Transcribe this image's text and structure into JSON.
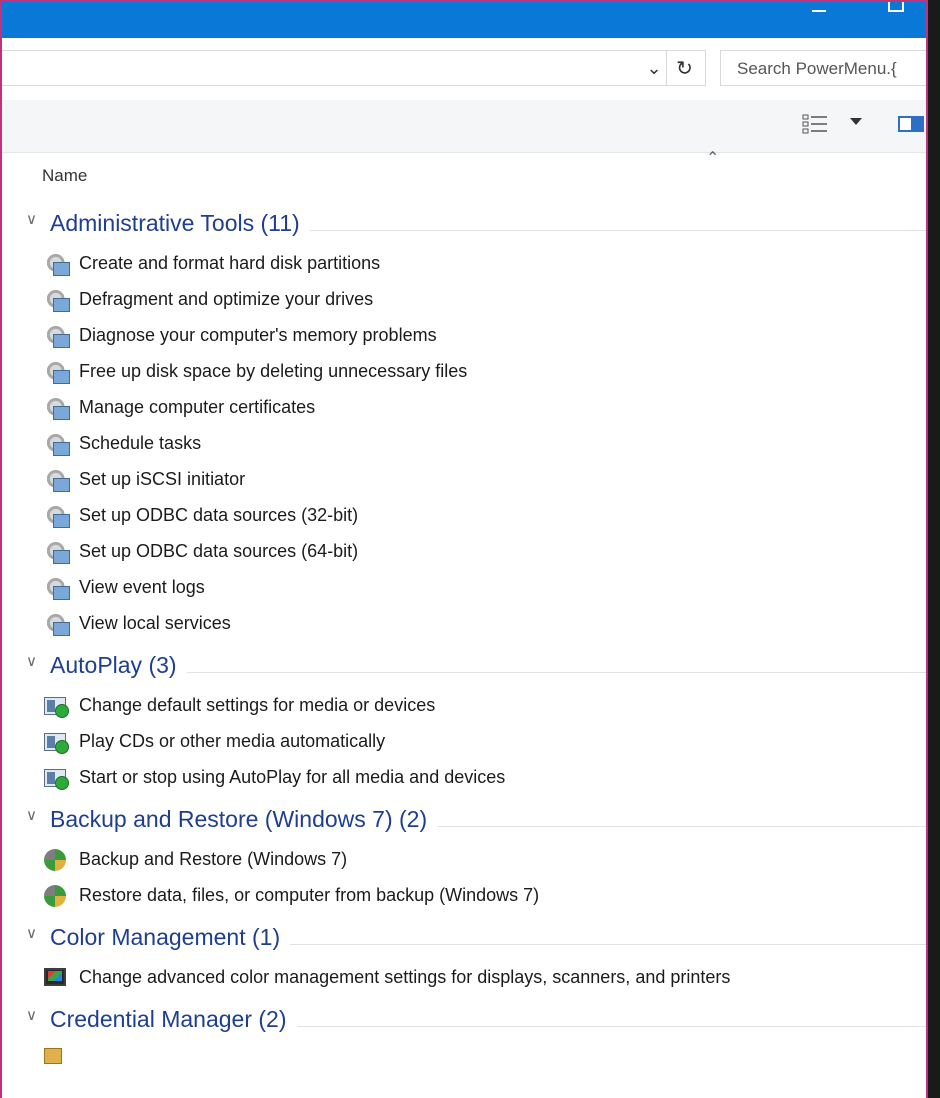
{
  "window": {
    "search_placeholder": "Search PowerMenu.{",
    "column_header": "Name"
  },
  "groups": [
    {
      "title": "Administrative Tools (11)",
      "icon": "admin-tools-icon",
      "items": [
        "Create and format hard disk partitions",
        "Defragment and optimize your drives",
        "Diagnose your computer's memory problems",
        "Free up disk space by deleting unnecessary files",
        "Manage computer certificates",
        "Schedule tasks",
        "Set up iSCSI initiator",
        "Set up ODBC data sources (32-bit)",
        "Set up ODBC data sources (64-bit)",
        "View event logs",
        "View local services"
      ]
    },
    {
      "title": "AutoPlay (3)",
      "icon": "autoplay-icon",
      "items": [
        "Change default settings for media or devices",
        "Play CDs or other media automatically",
        "Start or stop using AutoPlay for all media and devices"
      ]
    },
    {
      "title": "Backup and Restore (Windows 7) (2)",
      "icon": "backup-restore-icon",
      "items": [
        "Backup and Restore (Windows 7)",
        "Restore data, files, or computer from backup (Windows 7)"
      ]
    },
    {
      "title": "Color Management (1)",
      "icon": "color-management-icon",
      "items": [
        "Change advanced color management settings for displays, scanners, and printers"
      ]
    },
    {
      "title": "Credential Manager (2)",
      "icon": "credential-manager-icon",
      "items": [
        ""
      ]
    }
  ],
  "colors": {
    "titlebar": "#0a78d7",
    "group_title": "#1e3e8f",
    "window_border": "#c0337a"
  }
}
